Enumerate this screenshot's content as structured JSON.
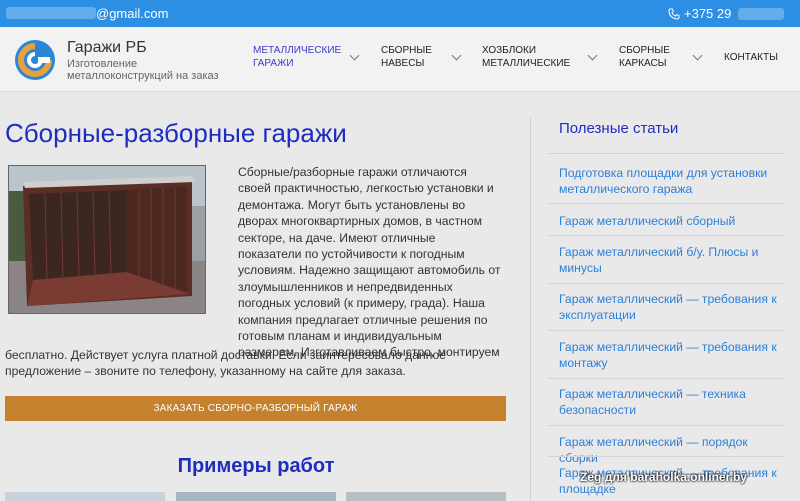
{
  "topbar": {
    "email_suffix": "@gmail.com",
    "phone_prefix": "+375 29"
  },
  "brand": {
    "name": "Гаражи РБ",
    "tagline": "Изготовление металлоконструкций на заказ"
  },
  "nav": [
    {
      "label": "Металлические гаражи",
      "active": true,
      "has_dropdown": true
    },
    {
      "label": "Сборные навесы",
      "active": false,
      "has_dropdown": true
    },
    {
      "label": "Хозблоки металлические",
      "active": false,
      "has_dropdown": true
    },
    {
      "label": "Сборные каркасы",
      "active": false,
      "has_dropdown": true
    },
    {
      "label": "Контакты",
      "active": false,
      "has_dropdown": false
    }
  ],
  "main": {
    "title": "Сборные-разборные гаражи",
    "intro": "Сборные/разборные гаражи отличаются своей практичностью, легкостью установки и демонтажа. Могут быть установлены во дворах многоквартирных домов, в частном секторе, на даче. Имеют отличные показатели по устойчивости к погодным условиям. Надежно защищают автомобиль от злоумышленников и непредвиденных погодных условий (к примеру, града). Наша компания предлагает отличные решения по готовым планам и индивидуальным размерам. Изготавливаем быстро, монтируем",
    "intro_tail": "бесплатно. Действует услуга платной доставки. Если заинтересовало данное предложение – звоните по телефону, указанному на сайте для заказа.",
    "order_button": "Заказать сборно-разборный гараж",
    "examples_title": "Примеры работ"
  },
  "sidebar": {
    "title": "Полезные статьи",
    "articles": [
      "Подготовка площадки для установки металлического гаража",
      "Гараж металлический сборный",
      "Гараж металлический б/у. Плюсы и минусы",
      "Гараж металлический — требования к эксплуатации",
      "Гараж металлический — требования к монтажу",
      "Гараж металлический — техника безопасности",
      "Гараж металлический — порядок сборки",
      "Гараж металлический — требования к площадке"
    ]
  },
  "watermark": "Zeg для baraholka.onliner.by",
  "colors": {
    "topbar": "#2d8fe4",
    "heading": "#1f2cc0",
    "link": "#2d7fd8",
    "button": "#c6812e"
  }
}
